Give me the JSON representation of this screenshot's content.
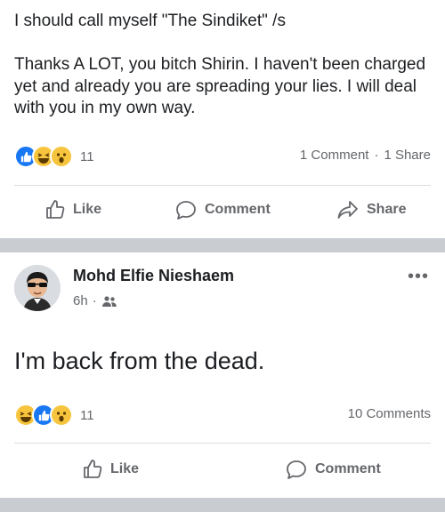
{
  "post1": {
    "text": "I should call myself \"The Sindiket\" /s\n\nThanks A LOT, you bitch Shirin. I haven't been charged yet and already you are spreading your lies. I will deal with you in my own way.",
    "reaction_icons": [
      "like-icon",
      "haha-icon",
      "wow-icon"
    ],
    "reaction_count": "11",
    "comments": "1 Comment",
    "shares": "1 Share",
    "actions": {
      "like": "Like",
      "comment": "Comment",
      "share": "Share"
    }
  },
  "post2": {
    "author": "Mohd Elfie Nieshaem",
    "time": "6h",
    "audience_icon": "friends-icon",
    "more_icon": "more-options-icon",
    "text": "I'm back from the dead.",
    "reaction_icons": [
      "haha-icon",
      "like-icon",
      "wow-icon"
    ],
    "reaction_count": "11",
    "comments": "10 Comments",
    "actions": {
      "like": "Like",
      "comment": "Comment"
    }
  },
  "colors": {
    "like_blue": "#1877f2",
    "emoji_yellow": "#f7c43d",
    "secondary_text": "#65676b",
    "band_gray": "#c9ccd1"
  }
}
